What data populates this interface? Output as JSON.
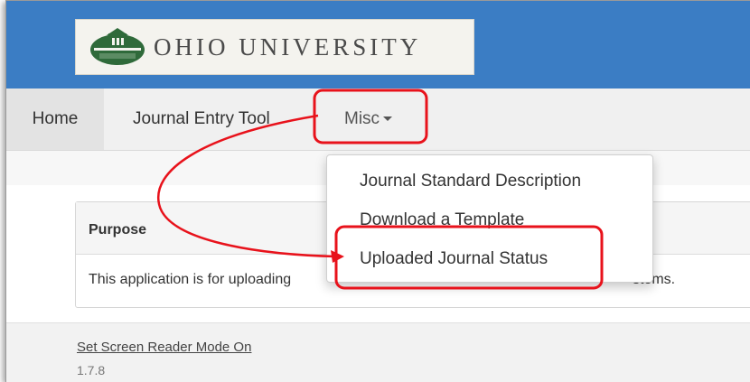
{
  "header": {
    "logo_text": "OHIO UNIVERSITY",
    "banner_color": "#3b7dc4"
  },
  "nav": {
    "items": [
      {
        "label": "Home"
      },
      {
        "label": "Journal Entry Tool"
      },
      {
        "label": "Misc"
      }
    ],
    "misc_dropdown": [
      {
        "label": "Journal Standard Description"
      },
      {
        "label": "Download a Template"
      },
      {
        "label": "Uploaded Journal Status"
      }
    ]
  },
  "panel": {
    "title": "Purpose",
    "body_visible_left": "This application is for uploading",
    "body_visible_right": "stems."
  },
  "footer": {
    "screen_reader_link": "Set Screen Reader Mode On",
    "version": "1.7.8"
  },
  "annotation": {
    "highlight_color": "#e8121b"
  },
  "icons": {
    "caret": "chevron-down-icon",
    "seal": "university-seal-icon"
  }
}
